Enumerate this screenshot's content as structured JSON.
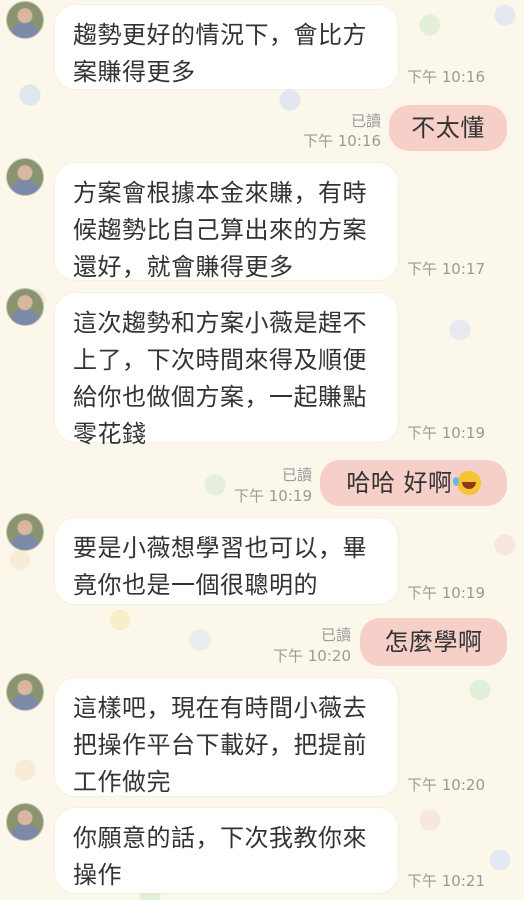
{
  "messages": [
    {
      "side": "in",
      "text": "趨勢更好的情況下，會比方案賺得更多",
      "time": "下午 10:16"
    },
    {
      "side": "out",
      "text": "不太懂",
      "read": "已讀",
      "time": "下午 10:16"
    },
    {
      "side": "in",
      "text": "方案會根據本金來賺，有時候趨勢比自己算出來的方案還好，就會賺得更多",
      "time": "下午 10:17"
    },
    {
      "side": "in",
      "text": "這次趨勢和方案小薇是趕不上了，下次時間來得及順便給你也做個方案，一起賺點零花錢",
      "time": "下午 10:19"
    },
    {
      "side": "out",
      "text": "哈哈 好啊",
      "emoji": "rolling-on-floor-laughing-emoji",
      "read": "已讀",
      "time": "下午 10:19"
    },
    {
      "side": "in",
      "text": "要是小薇想學習也可以，畢竟你也是一個很聰明的",
      "time": "下午 10:19"
    },
    {
      "side": "out",
      "text": "怎麼學啊",
      "read": "已讀",
      "time": "下午 10:20"
    },
    {
      "side": "in",
      "text": "這樣吧，現在有時間小薇去把操作平台下載好，把提前工作做完",
      "time": "下午 10:20"
    },
    {
      "side": "in",
      "text": "你願意的話，下次我教你來操作",
      "time": "下午 10:21"
    }
  ],
  "colors": {
    "background": "#fbf7ea",
    "incoming_bubble": "#ffffff",
    "outgoing_bubble": "#f6cfc8",
    "meta_text": "#9a9a9a"
  }
}
